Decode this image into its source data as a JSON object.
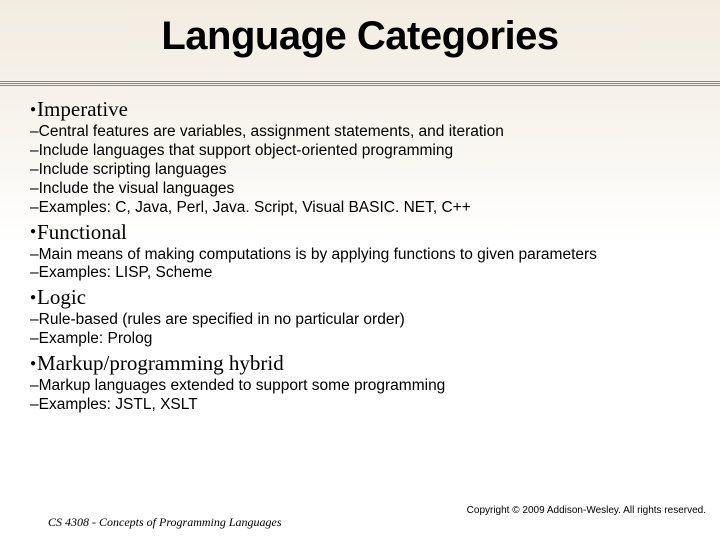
{
  "title": "Language Categories",
  "categories": [
    {
      "name": "Imperative",
      "items": [
        "Central features are variables, assignment statements, and iteration",
        "Include languages that support object-oriented programming",
        "Include scripting languages",
        "Include the visual languages",
        "Examples: C, Java, Perl, Java. Script, Visual BASIC. NET, C++"
      ]
    },
    {
      "name": "Functional",
      "items": [
        "Main means of making computations is by applying functions to given parameters",
        "Examples: LISP, Scheme"
      ]
    },
    {
      "name": "Logic",
      "items": [
        "Rule-based (rules are specified in no particular order)",
        "Example: Prolog"
      ]
    },
    {
      "name": "Markup/programming hybrid",
      "items": [
        "Markup languages extended to support some programming",
        "Examples: JSTL, XSLT"
      ]
    }
  ],
  "footer": {
    "left": "CS 4308 - Concepts of Programming Languages",
    "right": "Copyright © 2009 Addison-Wesley. All rights reserved."
  }
}
